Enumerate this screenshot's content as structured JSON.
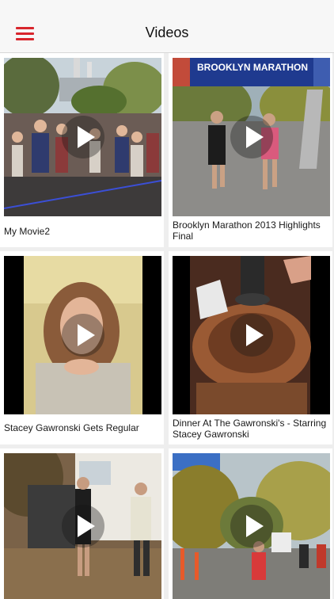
{
  "header": {
    "title": "Videos"
  },
  "videos": [
    {
      "title": "My Movie2"
    },
    {
      "title": "Brooklyn Marathon 2013 Highlights Final",
      "banner": "BROOKLYN MARATHON"
    },
    {
      "title": "Stacey Gawronski Gets Regular"
    },
    {
      "title": "Dinner At The Gawronski's - Starring Stacey Gawronski"
    },
    {
      "title": ""
    },
    {
      "title": ""
    }
  ]
}
